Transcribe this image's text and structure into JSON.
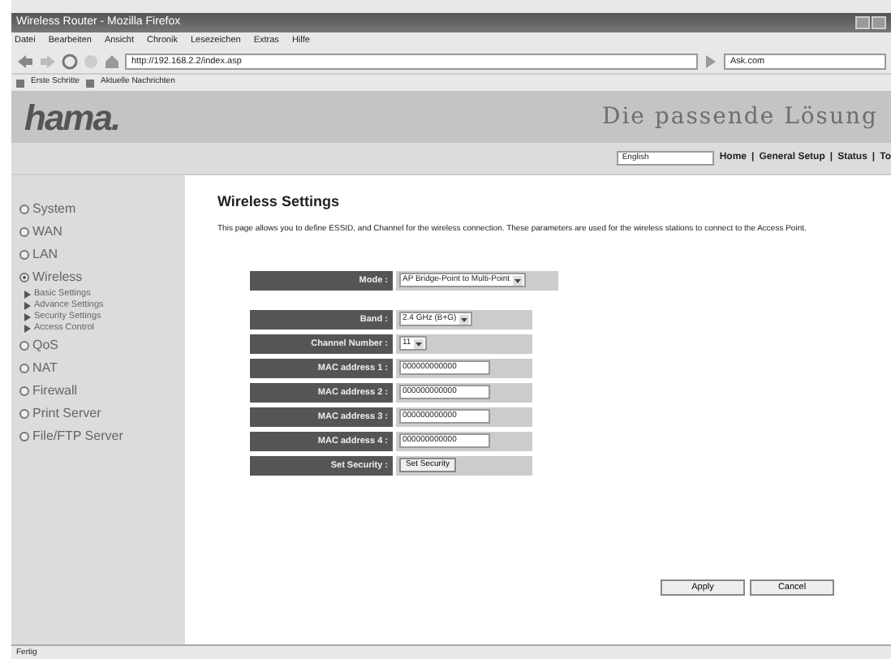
{
  "window": {
    "title": "Wireless Router - Mozilla Firefox"
  },
  "menu": [
    "Datei",
    "Bearbeiten",
    "Ansicht",
    "Chronik",
    "Lesezeichen",
    "Extras",
    "Hilfe"
  ],
  "address_bar": {
    "value": "http://192.168.2.2/index.asp"
  },
  "search": {
    "value": "Ask.com"
  },
  "bookmarks": [
    "Erste Schritte",
    "Aktuelle Nachrichten"
  ],
  "header": {
    "logo": "hama.",
    "slogan": "Die passende Lösung",
    "language": "English",
    "links": [
      "Home",
      "General Setup",
      "Status",
      "To"
    ],
    "separator": "|"
  },
  "sidebar": {
    "items": [
      {
        "label": "System",
        "selected": false
      },
      {
        "label": "WAN",
        "selected": false
      },
      {
        "label": "LAN",
        "selected": false
      },
      {
        "label": "Wireless",
        "selected": true,
        "children": [
          {
            "label": "Basic Settings"
          },
          {
            "label": "Advance Settings"
          },
          {
            "label": "Security Settings"
          },
          {
            "label": "Access Control"
          }
        ]
      },
      {
        "label": "QoS",
        "selected": false
      },
      {
        "label": "NAT",
        "selected": false
      },
      {
        "label": "Firewall",
        "selected": false
      },
      {
        "label": "Print Server",
        "selected": false
      },
      {
        "label": "File/FTP Server",
        "selected": false
      }
    ]
  },
  "page": {
    "title": "Wireless Settings",
    "description": "This page allows you to define ESSID, and Channel for the wireless connection. These parameters are used for the wireless stations to connect to the Access Point."
  },
  "form": {
    "groups": [
      [
        {
          "label": "Mode :",
          "kind": "select",
          "value": "AP Bridge-Point to Multi-Point"
        }
      ],
      [
        {
          "label": "Band :",
          "kind": "select",
          "value": "2.4 GHz (B+G)"
        },
        {
          "label": "Channel Number :",
          "kind": "select",
          "value": "11"
        },
        {
          "label": "MAC address 1 :",
          "kind": "text",
          "value": "000000000000"
        },
        {
          "label": "MAC address 2 :",
          "kind": "text",
          "value": "000000000000"
        },
        {
          "label": "MAC address 3 :",
          "kind": "text",
          "value": "000000000000"
        },
        {
          "label": "MAC address 4 :",
          "kind": "text",
          "value": "000000000000"
        },
        {
          "label": "Set Security :",
          "kind": "button",
          "value": "Set Security"
        }
      ]
    ]
  },
  "buttons": [
    "Apply",
    "Cancel"
  ],
  "status_bar": "Fertig"
}
